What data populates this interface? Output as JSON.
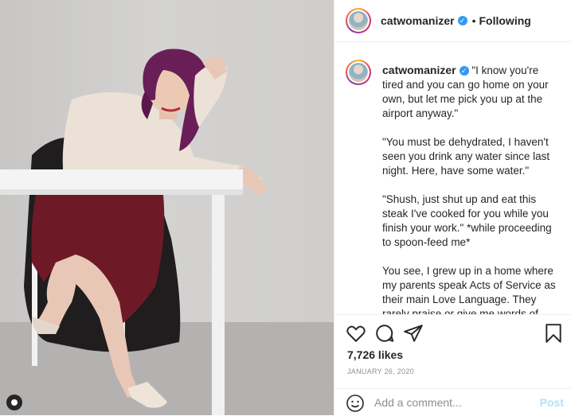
{
  "post": {
    "username": "catwomanizer",
    "verified_icon": "verified-check-icon",
    "separator": "•",
    "follow_status": "Following",
    "caption_paragraphs": [
      "\"I know you're tired and you can go home on your own, but let me pick you up at the airport anyway.\"",
      "\"You must be dehydrated, I haven't seen you drink any water since last night. Here, have some water.\"",
      "\"Shush, just shut up and eat this steak I've cooked for you while you finish your work.\" *while proceeding to spoon-feed me*",
      "You see, I grew up in a home where my parents speak Acts of Service as their main Love Language. They rarely praise or give me words of encouragement and affirmation, but they show me they love me without"
    ],
    "likes": "7,726 likes",
    "date": "JANUARY 26, 2020",
    "comment_placeholder": "Add a comment...",
    "post_button": "Post"
  },
  "icons": {
    "like": "heart-icon",
    "comment": "comment-icon",
    "share": "share-icon",
    "save": "bookmark-icon",
    "emoji": "smiley-icon",
    "tag": "user-tag-icon"
  },
  "colors": {
    "link_blue": "#3897f0",
    "post_disabled": "#b2dffc",
    "muted": "#8e8e8e"
  }
}
